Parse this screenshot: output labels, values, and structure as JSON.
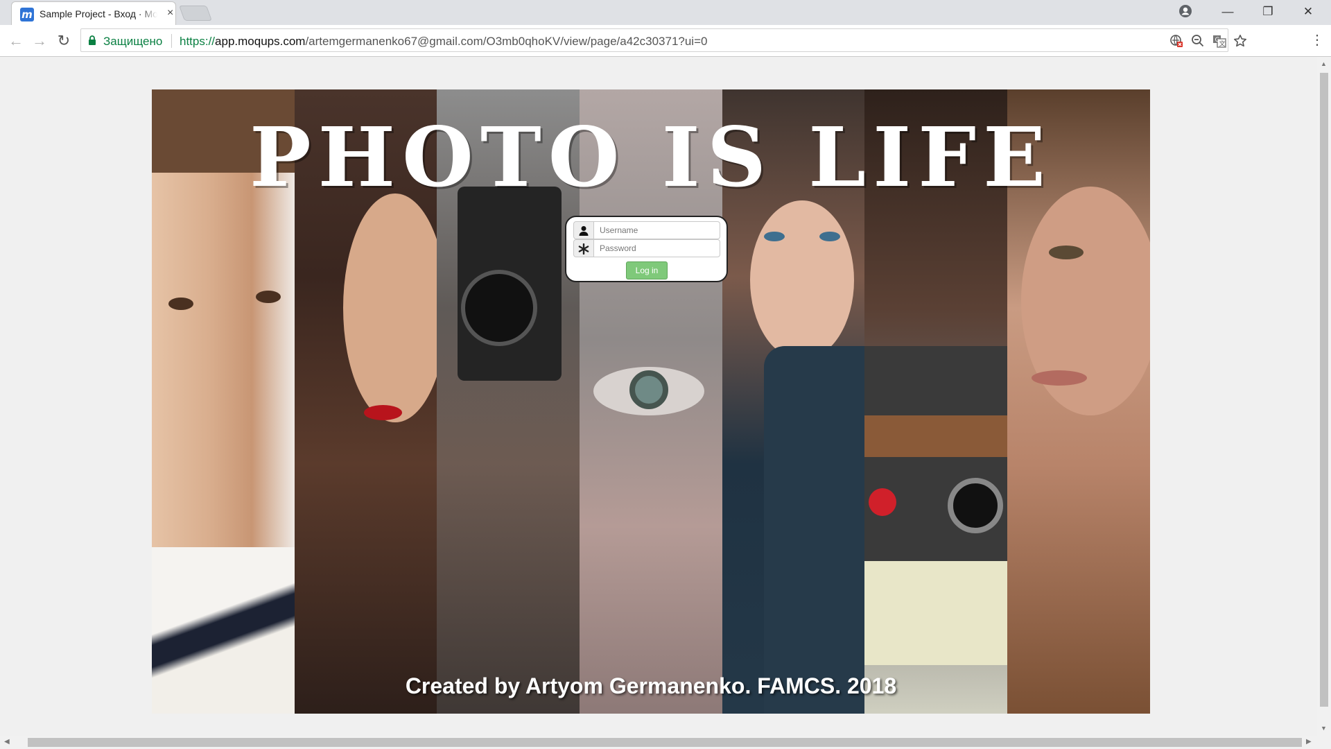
{
  "browser": {
    "tab_title": "Sample Project - Вход · Moqups",
    "tab_close": "×",
    "secure_label": "Защищено",
    "url_protocol": "https://",
    "url_host": "app.moqups.com",
    "url_path": "/artemgermanenko67@gmail.com/O3mb0qhoKV/view/page/a42c30371?ui=0",
    "favicon_letter": "m"
  },
  "page": {
    "title": "PHOTO IS LIFE",
    "credit": "Created by Artyom Germanenko. FAMCS. 2018"
  },
  "login": {
    "username_placeholder": "Username",
    "password_placeholder": "Password",
    "button_label": "Log in"
  },
  "colors": {
    "accent_green": "#7fc97a",
    "secure_green": "#0b8043",
    "favicon_blue": "#2f74d6"
  }
}
